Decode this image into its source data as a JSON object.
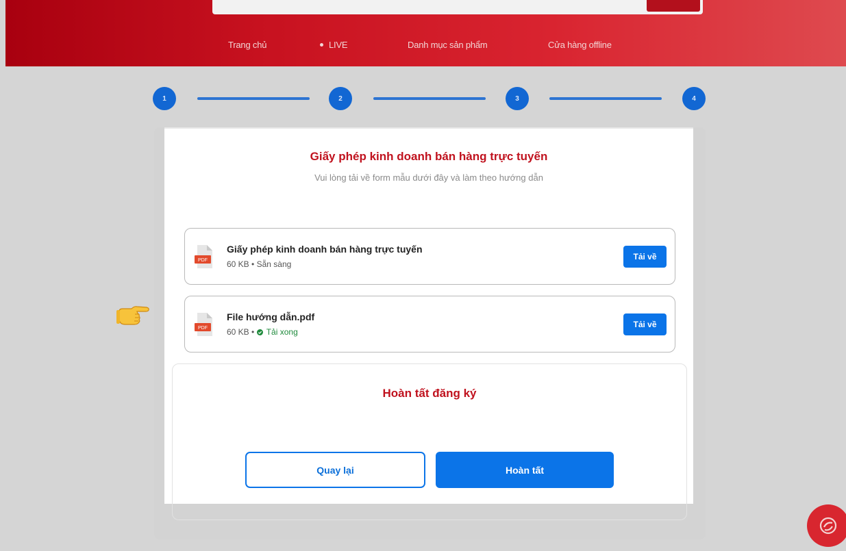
{
  "header": {
    "nav": [
      {
        "label": "Trang chủ"
      },
      {
        "label": "LIVE"
      },
      {
        "label": "Danh mục sản phẩm"
      },
      {
        "label": "Cửa hàng offline"
      }
    ]
  },
  "stepper": {
    "steps": [
      "1",
      "2",
      "3",
      "4"
    ],
    "active_color": "#1267d3"
  },
  "section": {
    "title": "Giấy phép kinh doanh bán hàng trực tuyến",
    "subtitle": "Vui lòng tải về form mẫu dưới đây và làm theo hướng dẫn"
  },
  "files": [
    {
      "icon": "pdf-file-icon",
      "icon_label": "PDF",
      "name": "Giấy phép kinh doanh bán hàng trực tuyến",
      "size": "60 KB",
      "separator": "•",
      "status": "Sẵn sàng",
      "button": "Tải về"
    },
    {
      "icon": "pdf-file-icon",
      "icon_label": "PDF",
      "name": "File hướng dẫn.pdf",
      "size": "60 KB",
      "separator": "•",
      "status": "Tải xong",
      "status_color": "#1f8a3c",
      "button": "Tải về"
    }
  ],
  "finish": {
    "title": "Hoàn tất đăng ký",
    "back_label": "Quay lại",
    "done_label": "Hoàn tất"
  },
  "colors": {
    "brand_red": "#c0121e",
    "primary_blue": "#0b74e8"
  }
}
